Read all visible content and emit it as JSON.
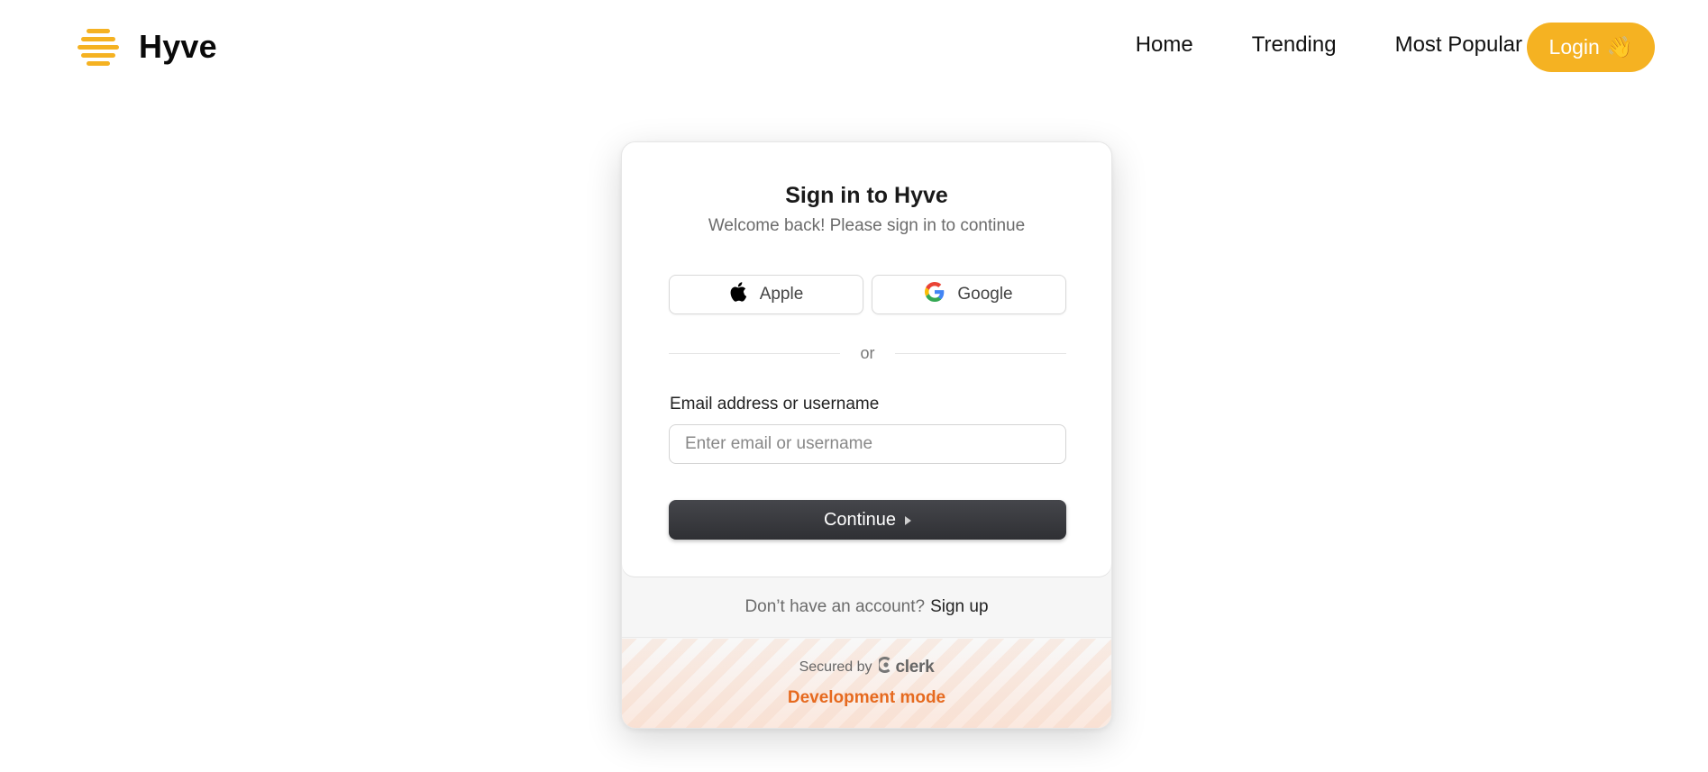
{
  "header": {
    "brand_name": "Hyve",
    "brand_color": "#f5b222",
    "nav": [
      {
        "label": "Home"
      },
      {
        "label": "Trending"
      },
      {
        "label": "Most Popular"
      }
    ],
    "login_label": "Login",
    "login_emoji": "👋"
  },
  "signin": {
    "title": "Sign in to Hyve",
    "subtitle": "Welcome back! Please sign in to continue",
    "apple_label": "Apple",
    "google_label": "Google",
    "divider_text": "or",
    "email_label": "Email address or username",
    "email_placeholder": "Enter email or username",
    "email_value": "",
    "continue_label": "Continue",
    "no_account_text": "Don’t have an account?",
    "signup_label": "Sign up",
    "secured_by": "Secured by",
    "clerk_brand": "clerk",
    "dev_mode": "Development mode",
    "dev_mode_color": "#e66a1f"
  }
}
